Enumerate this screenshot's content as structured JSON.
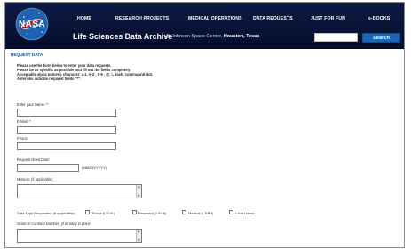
{
  "brand": {
    "logo_text": "NASA"
  },
  "nav": {
    "items": [
      {
        "label": "HOME"
      },
      {
        "label": "RESEARCH PROJECTS"
      },
      {
        "label": "MEDICAL OPERATIONS"
      },
      {
        "label": "DATA REQUESTS"
      },
      {
        "label": "JUST FOR FUN"
      },
      {
        "label": "e-BOOKS"
      }
    ]
  },
  "header": {
    "title": "Life Sciences Data Archive",
    "subtitle_prefix": "@ Johnson Space Center,",
    "subtitle_location": "Houston, Texas",
    "search_placeholder": "",
    "search_label": "Search"
  },
  "page": {
    "section_title": "REQUEST DATA",
    "instructions": [
      "Please use the form below to enter your data requests.",
      "Please be as specific as possible and fill out the fields completely.",
      "Acceptable alpha numeric character: a-z, A-Z , 0-9 , @, \\, dash, comma and dot.",
      "Asterisks indicate required fields \"*\"."
    ]
  },
  "form": {
    "fields": {
      "name_label": "Enter your Name:",
      "email_label": "E-Mail:",
      "phone_label": "Phone:",
      "date_label": "Request Need Date:",
      "date_hint": "(MM/DD/YYYY)",
      "mission_label": "Mission: (if applicable)",
      "grant_label": "Grant or Contract Number: (if already in place)"
    },
    "required_mark": "*",
    "data_type": {
      "label": "Data Type Requested: (if applicable):",
      "options": [
        {
          "label": "Tissue (LSDA)"
        },
        {
          "label": "Research (LSDA)"
        },
        {
          "label": "Medical (LSAH)"
        },
        {
          "label": "I don't know"
        }
      ]
    }
  },
  "colors": {
    "header_dark": "#0d1a44",
    "accent_blue": "#1b66b5",
    "title_blue": "#0f4c8a",
    "nasa_blue": "#1e62b1",
    "nasa_red": "#d11a1a"
  }
}
